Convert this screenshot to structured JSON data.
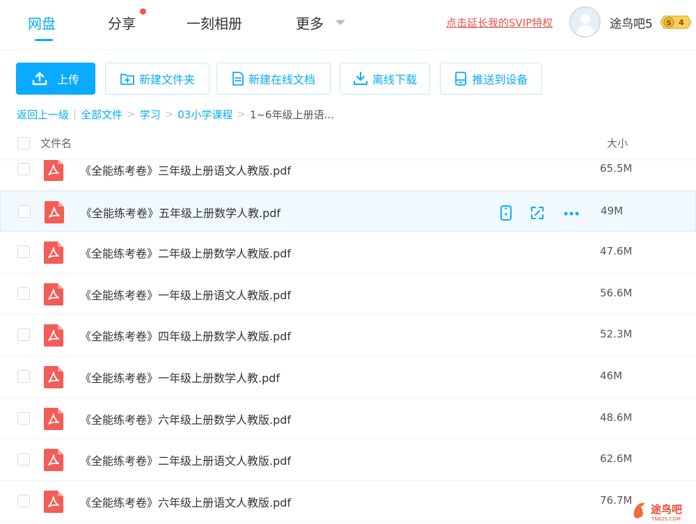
{
  "nav": {
    "items": [
      {
        "label": "网盘",
        "active": true
      },
      {
        "label": "分享",
        "dot": true
      },
      {
        "label": "一刻相册"
      },
      {
        "label": "更多",
        "caret": true
      }
    ],
    "svip_link": "点击延长我的SVIP特权",
    "username": "途鸟吧5",
    "badge_level": "4"
  },
  "toolbar": {
    "upload": "上传",
    "new_folder": "新建文件夹",
    "new_doc": "新建在线文档",
    "offline_download": "离线下载",
    "push_device": "推送到设备"
  },
  "breadcrumb": {
    "back": "返回上一级",
    "items": [
      "全部文件",
      "学习",
      "03小学课程"
    ],
    "current": "1~6年级上册语..."
  },
  "list_header": {
    "name": "文件名",
    "size": "大小"
  },
  "files": [
    {
      "name": "《全能练考卷》三年级上册语文人教版.pdf",
      "size": "65.5M"
    },
    {
      "name": "《全能练考卷》五年级上册数学人教.pdf",
      "size": "49M",
      "hover": true
    },
    {
      "name": "《全能练考卷》二年级上册数学人教版.pdf",
      "size": "47.6M"
    },
    {
      "name": "《全能练考卷》一年级上册语文人教版.pdf",
      "size": "56.6M"
    },
    {
      "name": "《全能练考卷》四年级上册数学人教版.pdf",
      "size": "52.3M"
    },
    {
      "name": "《全能练考卷》一年级上册数学人教.pdf",
      "size": "46M"
    },
    {
      "name": "《全能练考卷》六年级上册数学人教版.pdf",
      "size": "48.6M"
    },
    {
      "name": "《全能练考卷》二年级上册语文人教版.pdf",
      "size": "62.6M"
    },
    {
      "name": "《全能练考卷》六年级上册语文人教版.pdf",
      "size": "76.7M"
    }
  ],
  "watermark": {
    "text": "途鸟吧",
    "sub": "TNB2S.COM"
  },
  "colors": {
    "accent": "#09aaff",
    "pdf": "#f35c57",
    "svip": "#e8534f"
  }
}
